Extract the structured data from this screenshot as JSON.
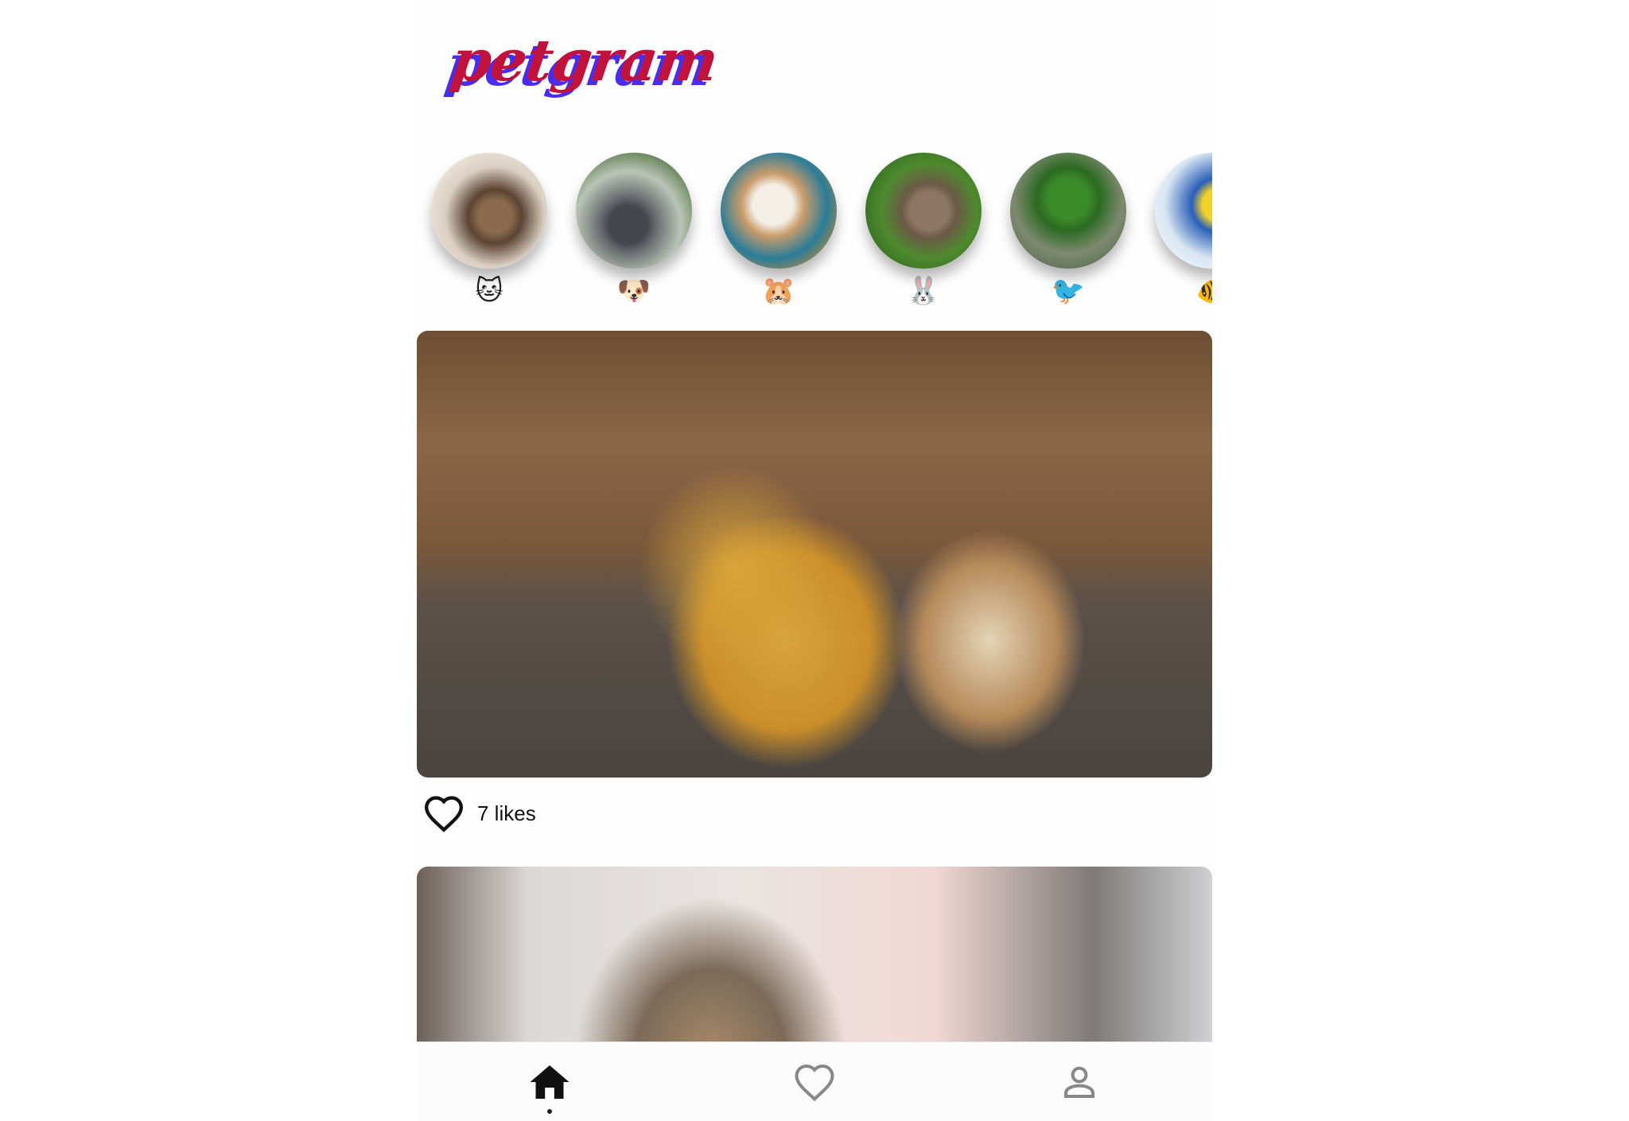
{
  "app": {
    "logo_text": "petgram"
  },
  "categories": [
    {
      "name": "cat",
      "emoji": "🐱"
    },
    {
      "name": "dog",
      "emoji": "🐶"
    },
    {
      "name": "hamster",
      "emoji": "🐹"
    },
    {
      "name": "rabbit",
      "emoji": "🐰"
    },
    {
      "name": "bird",
      "emoji": "🐦"
    },
    {
      "name": "fish",
      "emoji": "🐠"
    }
  ],
  "posts": [
    {
      "likes_text": "7 likes"
    },
    {
      "likes_text": ""
    }
  ],
  "navbar": {
    "items": [
      {
        "name": "home",
        "active": true
      },
      {
        "name": "favorites",
        "active": false
      },
      {
        "name": "user",
        "active": false
      }
    ]
  }
}
